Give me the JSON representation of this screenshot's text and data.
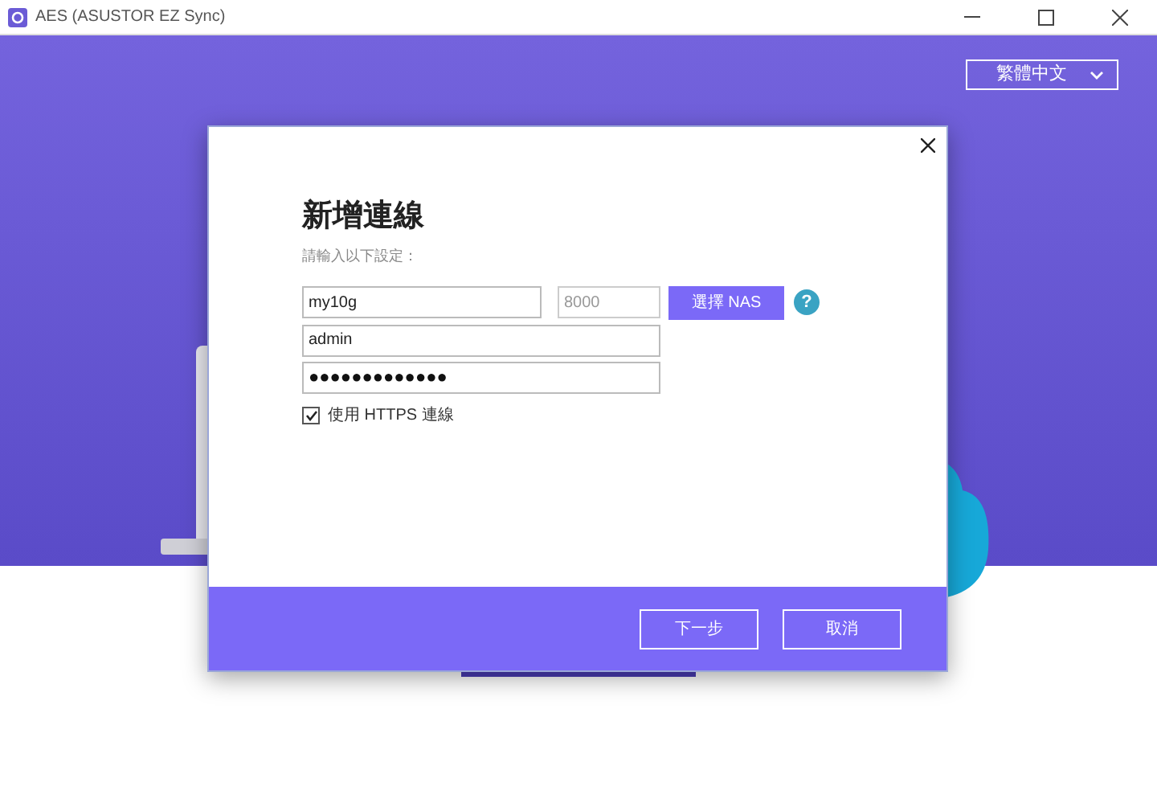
{
  "window": {
    "title": "AES (ASUSTOR EZ Sync)"
  },
  "language": {
    "value": "繁體中文"
  },
  "dialog": {
    "title": "新增連線",
    "subtitle": "請輸入以下設定：",
    "host": {
      "value": "my10g"
    },
    "port": {
      "placeholder": "8000"
    },
    "select_nas": "選擇 NAS",
    "help": "?",
    "username": {
      "value": "admin"
    },
    "password": {
      "value": "●●●●●●●●●●●●●"
    },
    "https": {
      "label": "使用 HTTPS 連線",
      "checked": true
    },
    "buttons": [
      "下一步",
      "取消"
    ]
  }
}
